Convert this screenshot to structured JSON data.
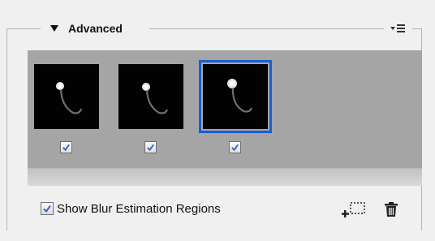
{
  "section": {
    "title": "Advanced",
    "flyout_menu_icon": "panel-menu-icon"
  },
  "regions": [
    {
      "id": 1,
      "checked": true,
      "selected": false,
      "thumbnail": "blur-kernel-thumbnail"
    },
    {
      "id": 2,
      "checked": true,
      "selected": false,
      "thumbnail": "blur-kernel-thumbnail"
    },
    {
      "id": 3,
      "checked": true,
      "selected": true,
      "thumbnail": "blur-kernel-thumbnail"
    }
  ],
  "footer": {
    "show_regions_label": "Show Blur Estimation Regions",
    "show_regions_checked": true,
    "add_region_icon": "add-region-icon",
    "delete_icon": "trash-icon"
  },
  "colors": {
    "panel_bg": "#f0f0f0",
    "regions_bg": "#a5a5a5",
    "selection": "#1a5dd6",
    "check": "#2f63c9"
  }
}
